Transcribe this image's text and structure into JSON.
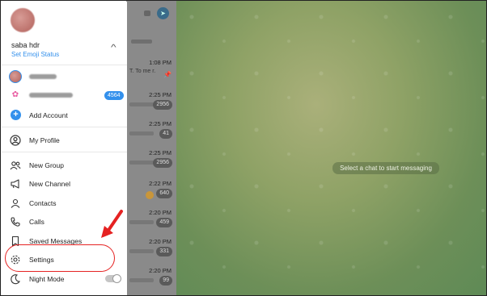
{
  "profile": {
    "name": "saba hdr",
    "emoji_status": "Set Emoji Status"
  },
  "accounts": {
    "add_label": "Add Account",
    "second_badge": "4564"
  },
  "menu": {
    "my_profile": "My Profile",
    "new_group": "New Group",
    "new_channel": "New Channel",
    "contacts": "Contacts",
    "calls": "Calls",
    "saved_messages": "Saved Messages",
    "settings": "Settings",
    "night_mode": "Night Mode"
  },
  "chat_list": {
    "rows": [
      {
        "time": "1:08 PM",
        "preview": "T. To me r."
      },
      {
        "time": "2:25 PM",
        "badge": "2956"
      },
      {
        "time": "2:25 PM",
        "badge": "41"
      },
      {
        "time": "2:25 PM",
        "badge": "2956"
      },
      {
        "time": "2:22 PM",
        "badge": "640"
      },
      {
        "time": "2:20 PM",
        "badge": "459"
      },
      {
        "time": "2:20 PM",
        "badge": "331"
      },
      {
        "time": "2:20 PM",
        "badge": "99"
      }
    ]
  },
  "chat_area": {
    "empty_message": "Select a chat to start messaging"
  },
  "colors": {
    "accent": "#3390ec",
    "highlight": "#e52222"
  },
  "night_mode_enabled": false
}
